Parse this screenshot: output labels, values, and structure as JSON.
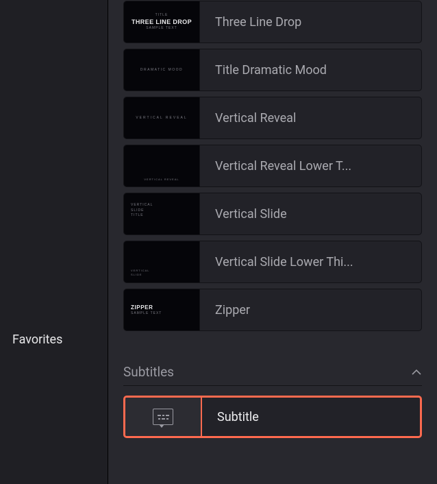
{
  "sidebar": {
    "favorites_label": "Favorites"
  },
  "section": {
    "subtitles_label": "Subtitles"
  },
  "presets": [
    {
      "label": "Three Line Drop",
      "thumb": {
        "line1": "TITLE",
        "line2": "THREE LINE DROP",
        "line3": "SAMPLE TEXT"
      }
    },
    {
      "label": "Title Dramatic Mood",
      "thumb": {
        "center": "DRAMATIC MOOD"
      }
    },
    {
      "label": "Vertical Reveal",
      "thumb": {
        "center": "VERTICAL REVEAL"
      }
    },
    {
      "label": "Vertical Reveal Lower T...",
      "thumb": {
        "bottom": "VERTICAL REVEAL"
      }
    },
    {
      "label": "Vertical Slide",
      "thumb": {
        "l1": "VERTICAL",
        "l2": "SLIDE",
        "l3": "TITLE"
      }
    },
    {
      "label": "Vertical Slide Lower Thi...",
      "thumb": {
        "l1": "VERTICAL",
        "l2": "SLIDE"
      }
    },
    {
      "label": "Zipper",
      "thumb": {
        "l1": "ZIPPER",
        "l2": "SAMPLE TEXT"
      }
    }
  ],
  "subtitle_item": {
    "label": "Subtitle"
  }
}
